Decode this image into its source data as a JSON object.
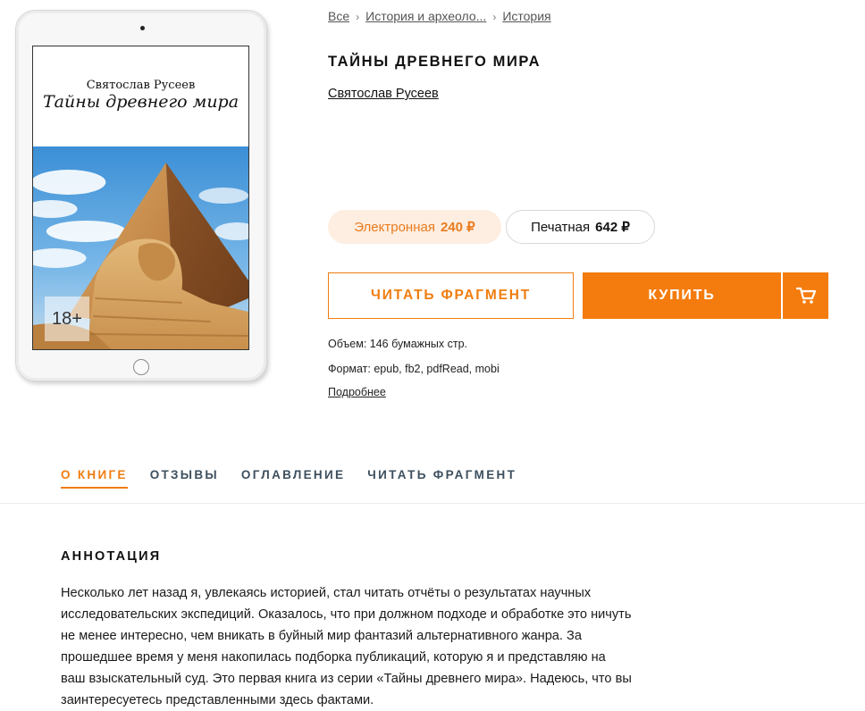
{
  "breadcrumb": {
    "items": [
      "Все",
      "История и археоло...",
      "История"
    ],
    "separator": "›"
  },
  "book": {
    "title": "ТАЙНЫ ДРЕВНЕГО МИРА",
    "author": "Святослав Русеев"
  },
  "cover": {
    "author": "Святослав Русеев",
    "title": "Тайны древнего мира",
    "age_badge": "18+"
  },
  "prices": {
    "electronic_label": "Электронная",
    "electronic_amount": "240 ₽",
    "print_label": "Печатная",
    "print_amount": "642 ₽"
  },
  "actions": {
    "read_fragment": "ЧИТАТЬ ФРАГМЕНТ",
    "buy": "КУПИТЬ",
    "cart_icon": "cart-icon"
  },
  "meta": {
    "volume": "Объем: 146 бумажных стр.",
    "format": "Формат: epub, fb2, pdfRead, mobi",
    "more_link": "Подробнее"
  },
  "tabs": [
    {
      "label": "О КНИГЕ",
      "active": true
    },
    {
      "label": "ОТЗЫВЫ",
      "active": false
    },
    {
      "label": "ОГЛАВЛЕНИЕ",
      "active": false
    },
    {
      "label": "ЧИТАТЬ ФРАГМЕНТ",
      "active": false
    }
  ],
  "annotation": {
    "heading": "АННОТАЦИЯ",
    "text": "Несколько лет назад я, увлекаясь историей, стал читать отчёты о результатах научных исследовательских экспедиций. Оказалось, что при должном подходе и обработке это ничуть не менее интересно, чем вникать в буйный мир фантазий альтернативного жанра. За прошедшее время у меня накопилась подборка публикаций, которую я и представляю на ваш взыскательный суд. Это первая книга из серии «Тайны древнего мира». Надеюсь, что вы заинтересуетесь представленными здесь фактами."
  },
  "colors": {
    "accent": "#f47c0e",
    "accent_light": "#fdeee1",
    "tab_inactive": "#3d4f5e"
  }
}
